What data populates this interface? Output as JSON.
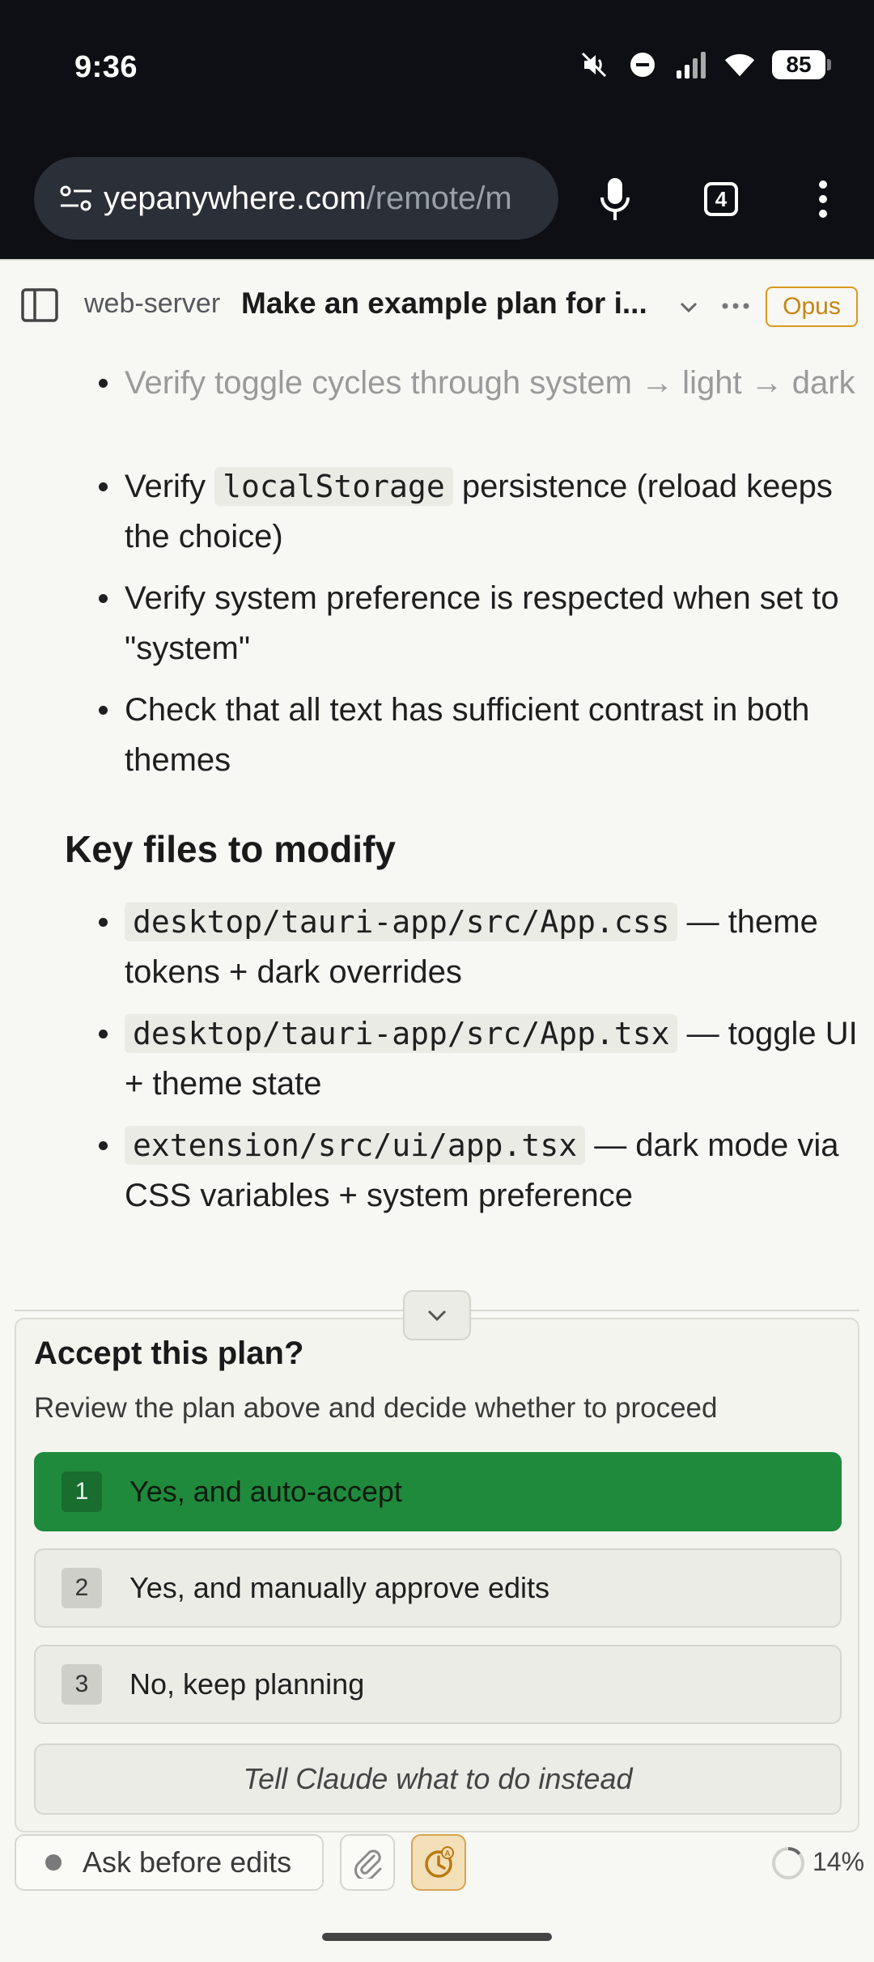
{
  "status_bar": {
    "time": "9:36",
    "battery": "85"
  },
  "browser": {
    "url_host": "yepanywhere.com",
    "url_path": "/remote/m",
    "tab_count": "4"
  },
  "header": {
    "project": "web-server",
    "title": "Make an example plan for i...",
    "model": "Opus"
  },
  "plan": {
    "verify_items": [
      {
        "text": "Verify toggle cycles through system → light → dark"
      },
      {
        "before": "Verify ",
        "code": "localStorage",
        "after": " persistence (reload keeps the choice)"
      },
      {
        "text": "Verify system preference is respected when set to \"system\""
      },
      {
        "text": "Check that all text has sufficient contrast in both themes"
      }
    ],
    "key_files_heading": "Key files to modify",
    "files": [
      {
        "path": "desktop/tauri-app/src/App.css",
        "desc": " — theme tokens + dark overrides"
      },
      {
        "path": "desktop/tauri-app/src/App.tsx",
        "desc": " — toggle UI + theme state"
      },
      {
        "path": "extension/src/ui/app.tsx",
        "desc": " — dark mode via CSS variables + system preference"
      }
    ]
  },
  "approval": {
    "title": "Accept this plan?",
    "description": "Review the plan above and decide whether to proceed",
    "options": [
      {
        "num": "1",
        "label": "Yes, and auto-accept",
        "selected": true
      },
      {
        "num": "2",
        "label": "Yes, and manually approve edits",
        "selected": false
      },
      {
        "num": "3",
        "label": "No, keep planning",
        "selected": false
      }
    ],
    "instead_label": "Tell Claude what to do instead"
  },
  "toolbar": {
    "mode_label": "Ask before edits",
    "context_percent": "14%"
  },
  "colors": {
    "accept_green": "#1f8a3c",
    "model_badge": "#d99a1e",
    "auto_button": "#f3dfb8"
  }
}
